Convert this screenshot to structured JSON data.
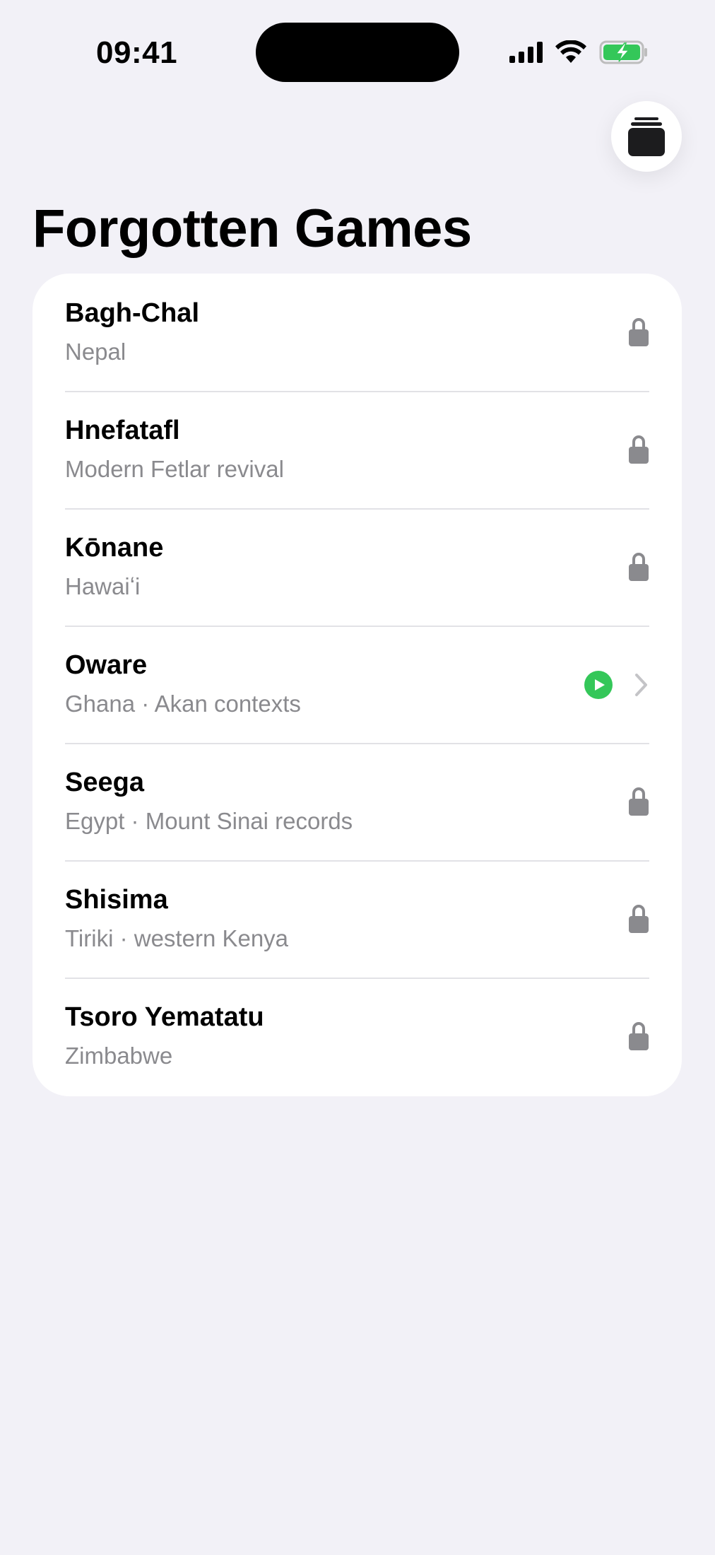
{
  "status": {
    "time": "09:41",
    "battery_color": "#34c759"
  },
  "header": {
    "title": "Forgotten Games",
    "stack_icon": "stack-icon"
  },
  "games": [
    {
      "title": "Bagh-Chal",
      "subtitle": "Nepal",
      "state": "locked"
    },
    {
      "title": "Hnefatafl",
      "subtitle": "Modern Fetlar revival",
      "state": "locked"
    },
    {
      "title": "Kōnane",
      "subtitle": "Hawaiʻi",
      "state": "locked"
    },
    {
      "title": "Oware",
      "subtitle": "Ghana · Akan contexts",
      "state": "playable"
    },
    {
      "title": "Seega",
      "subtitle": "Egypt · Mount Sinai records",
      "state": "locked"
    },
    {
      "title": "Shisima",
      "subtitle": "Tiriki · western Kenya",
      "state": "locked"
    },
    {
      "title": "Tsoro Yematatu",
      "subtitle": "Zimbabwe",
      "state": "locked"
    }
  ],
  "colors": {
    "play_accent": "#34c759",
    "lock": "#8a8a8e",
    "background": "#f2f1f7"
  }
}
